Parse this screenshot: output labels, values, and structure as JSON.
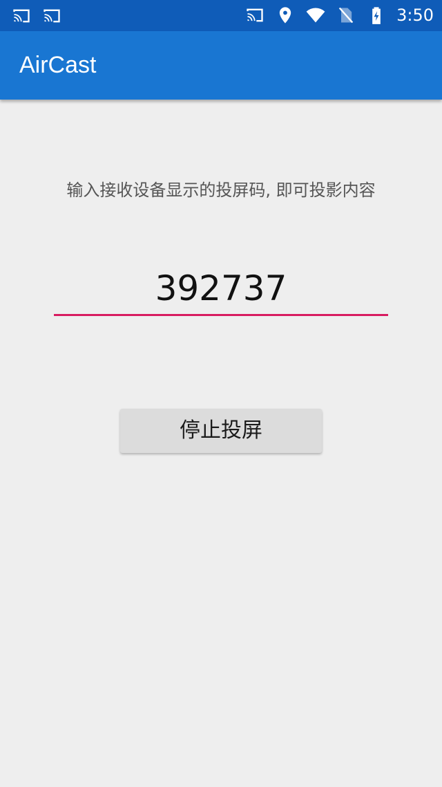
{
  "status_bar": {
    "left_icons": [
      "cast-icon",
      "cast-icon"
    ],
    "right_icons": [
      "cast-icon",
      "location-icon",
      "wifi-icon",
      "no-sim-icon",
      "battery-charging-icon"
    ],
    "time": "3:50",
    "background": "#0f5cb8"
  },
  "app_bar": {
    "title": "AirCast",
    "background": "#1976d2"
  },
  "main": {
    "instruction": "输入接收设备显示的投屏码, 即可投影内容",
    "code_value": "392737",
    "accent": "#d81b60",
    "stop_button_label": "停止投屏"
  }
}
